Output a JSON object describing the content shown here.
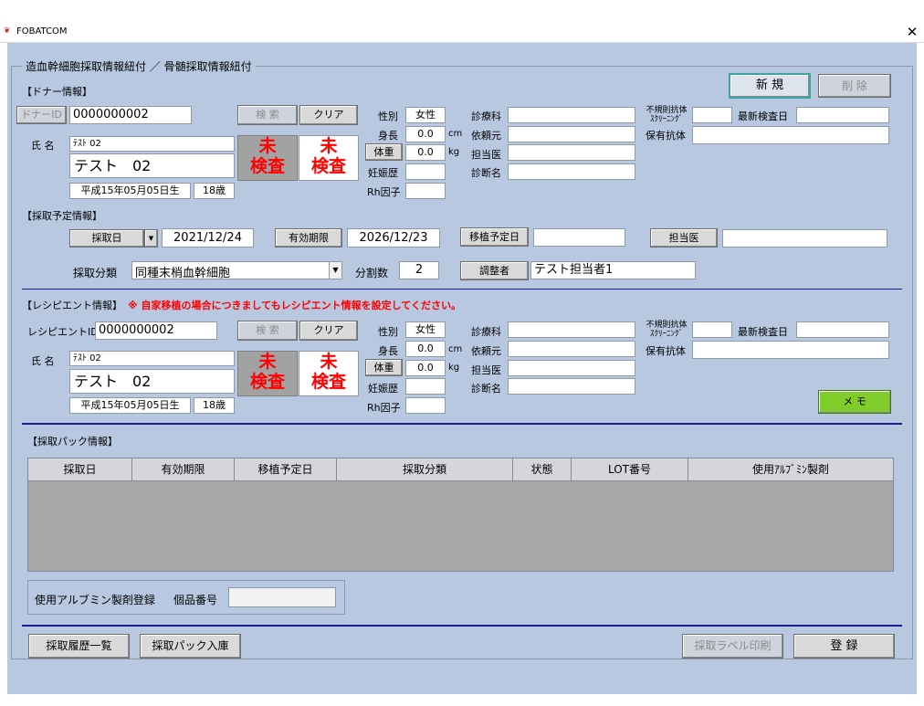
{
  "window": {
    "title": "FOBATCOM",
    "close_glyph": "✕"
  },
  "group_title": "造血幹細胞採取情報紐付 ／ 骨髄採取情報紐付",
  "actions": {
    "new": "新 規",
    "delete": "削 除",
    "memo": "メ モ"
  },
  "donor": {
    "section": "【ドナー情報】",
    "id_button": "ドナーID",
    "id_value": "0000000002",
    "search": "検 索",
    "clear": "クリア",
    "name_label": "氏 名",
    "kana": "ﾃｽﾄ 02",
    "name": "テスト　02",
    "birth": "平成15年05月05日生",
    "age": "18歳",
    "test1": "未\n検査",
    "test2": "未\n検査",
    "sex_label": "性別",
    "sex": "女性",
    "height_label": "身長",
    "height": "0.0",
    "height_unit": "cm",
    "weight_label": "体重",
    "weight": "0.0",
    "weight_unit": "kg",
    "preg_label": "妊娠歴",
    "rh_label": "Rh因子",
    "dept_label": "診療科",
    "dept": "",
    "ref_label": "依頼元",
    "ref": "",
    "doctor_label": "担当医",
    "doctor": "",
    "diag_label": "診断名",
    "diag": "",
    "irregular_label": "不規則抗体\nｽｸﾘｰﾆﾝｸﾞ",
    "latest_label": "最新検査日",
    "antibody_label": "保有抗体"
  },
  "plan": {
    "section": "【採取予定情報】",
    "date_button": "採取日",
    "date": "2021/12/24",
    "expire_button": "有効期限",
    "expire": "2026/12/23",
    "transplant_button": "移植予定日",
    "transplant": "",
    "doctor_button": "担当医",
    "doctor": "",
    "class_label": "採取分類",
    "class_value": "同種末梢血幹細胞",
    "split_label": "分割数",
    "split": "2",
    "adjuster_button": "調整者",
    "adjuster": "テスト担当者1"
  },
  "recipient": {
    "section": "【レシピエント情報】",
    "warning": "※ 自家移植の場合につきましてもレシピエント情報を設定してください。",
    "id_label": "レシピエントID",
    "id_value": "0000000002",
    "search": "検 索",
    "clear": "クリア",
    "name_label": "氏 名",
    "kana": "ﾃｽﾄ 02",
    "name": "テスト　02",
    "birth": "平成15年05月05日生",
    "age": "18歳",
    "test1": "未\n検査",
    "test2": "未\n検査",
    "sex_label": "性別",
    "sex": "女性",
    "height_label": "身長",
    "height": "0.0",
    "height_unit": "cm",
    "weight_label": "体重",
    "weight": "0.0",
    "weight_unit": "kg",
    "preg_label": "妊娠歴",
    "rh_label": "Rh因子",
    "dept_label": "診療科",
    "ref_label": "依頼元",
    "doctor_label": "担当医",
    "diag_label": "診断名",
    "irregular_label": "不規則抗体\nｽｸﾘｰﾆﾝｸﾞ",
    "latest_label": "最新検査日",
    "antibody_label": "保有抗体"
  },
  "pack": {
    "section": "【採取パック情報】",
    "columns": [
      "採取日",
      "有効期限",
      "移植予定日",
      "採取分類",
      "状態",
      "LOT番号",
      "使用ｱﾙﾌﾞﾐﾝ製剤"
    ]
  },
  "albumin": {
    "label": "使用アルブミン製剤登録",
    "serial_label": "個品番号",
    "serial": ""
  },
  "footer": {
    "history": "採取履歴一覧",
    "pack_in": "採取パック入庫",
    "label_print": "採取ラベル印刷",
    "register": "登 録"
  }
}
